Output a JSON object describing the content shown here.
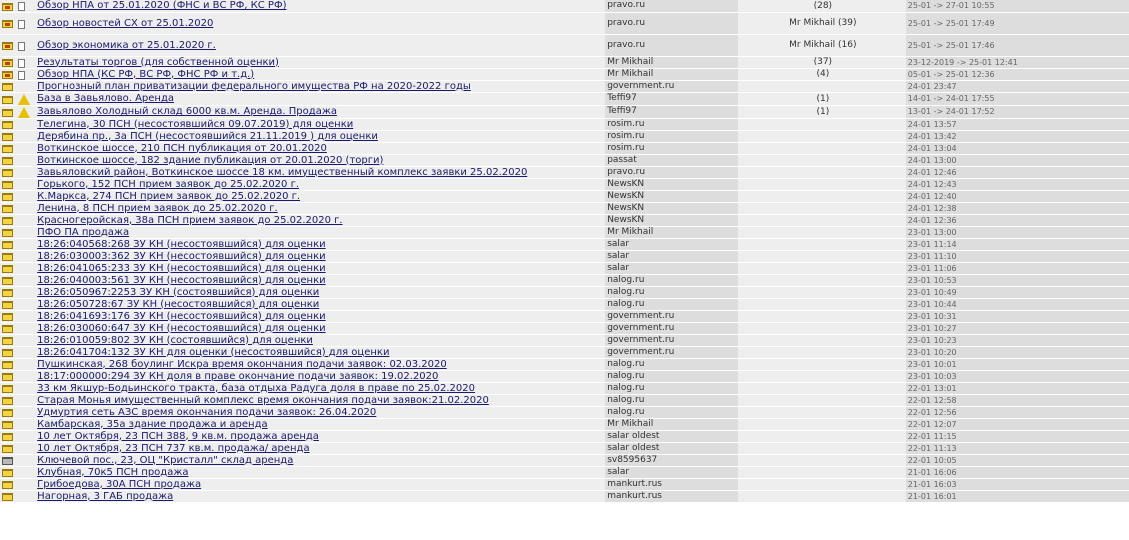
{
  "topics": [
    {
      "icon": "hot",
      "doc": true,
      "title": "Обзор НПА от 25.01.2020 (ФНС и ВС РФ, КС РФ)",
      "author": "pravo.ru",
      "replies": "(28)",
      "date": "25-01 -> 27-01 10:55",
      "tall": false
    },
    {
      "icon": "hot",
      "doc": true,
      "title": "Обзор новостей СХ от 25.01.2020",
      "author": "pravo.ru",
      "replies": "Mr Mikhail\n(39)",
      "date": "25-01 -> 25-01 17:49",
      "tall": true
    },
    {
      "icon": "hot",
      "doc": true,
      "title": "Обзор экономика от 25.01.2020 г.",
      "author": "pravo.ru",
      "replies": "Mr Mikhail\n(16)",
      "date": "25-01 -> 25-01 17:46",
      "tall": true
    },
    {
      "icon": "hot",
      "doc": true,
      "title": "Результаты торгов (для собственной оценки)",
      "author": "Mr Mikhail",
      "replies": "(37)",
      "date": "23-12-2019 -> 25-01 12:41",
      "tall": false
    },
    {
      "icon": "hot",
      "doc": true,
      "title": "Обзор НПА (КС РФ, ВС РФ, ФНС РФ и т.д.)",
      "author": "Mr Mikhail",
      "replies": "(4)",
      "date": "05-01 -> 25-01 12:36",
      "tall": false
    },
    {
      "icon": "folder",
      "doc": false,
      "title": "Прогнозный план приватизации федерального имущества РФ на 2020-2022 годы",
      "author": "government.ru",
      "replies": "",
      "date": "24-01 23:47",
      "tall": false
    },
    {
      "icon": "folder",
      "doc": "warn",
      "title": "База в Завьялово. Аренда",
      "author": "Teffi97",
      "replies": "(1)",
      "date": "14-01 -> 24-01 17:55",
      "tall": false
    },
    {
      "icon": "folder",
      "doc": "warn",
      "title": "Завьялово Холодный склад 6000 кв.м. Аренда. Продажа",
      "author": "Teffi97",
      "replies": "(1)",
      "date": "13-01 -> 24-01 17:52",
      "tall": false
    },
    {
      "icon": "folder",
      "doc": false,
      "title": "Телегина, 30 ПСН (несостоявшийся 09.07.2019) для оценки",
      "author": "rosim.ru",
      "replies": "",
      "date": "24-01 13:57",
      "tall": false
    },
    {
      "icon": "folder",
      "doc": false,
      "title": "Дерябина пр., 3а ПСН (несостоявшийся 21.11.2019 ) для оценки",
      "author": "rosim.ru",
      "replies": "",
      "date": "24-01 13:42",
      "tall": false
    },
    {
      "icon": "folder",
      "doc": false,
      "title": "Воткинское шоссе, 210 ПСН публикация от 20.01.2020",
      "author": "rosim.ru",
      "replies": "",
      "date": "24-01 13:04",
      "tall": false
    },
    {
      "icon": "folder",
      "doc": false,
      "title": "Воткинское шоссе, 182 здание публикация от 20.01.2020 (торги)",
      "author": "passat",
      "replies": "",
      "date": "24-01 13:00",
      "tall": false
    },
    {
      "icon": "folder",
      "doc": false,
      "title": "Завьяловский район, Воткинское шоссе 18 км. имущественный комплекс заявки 25.02.2020",
      "author": "pravo.ru",
      "replies": "",
      "date": "24-01 12:46",
      "tall": false
    },
    {
      "icon": "folder",
      "doc": false,
      "title": "Горького, 152 ПСН прием заявок до 25.02.2020 г.",
      "author": "NewsKN",
      "replies": "",
      "date": "24-01 12:43",
      "tall": false
    },
    {
      "icon": "folder",
      "doc": false,
      "title": "К.Маркса, 274 ПСН прием заявок до 25.02.2020 г.",
      "author": "NewsKN",
      "replies": "",
      "date": "24-01 12:40",
      "tall": false
    },
    {
      "icon": "folder",
      "doc": false,
      "title": "Ленина, 8 ПСН прием заявок до 25.02.2020 г.",
      "author": "NewsKN",
      "replies": "",
      "date": "24-01 12:38",
      "tall": false
    },
    {
      "icon": "folder",
      "doc": false,
      "title": "Красногеройская, 38а ПСН прием заявок до 25.02.2020 г.",
      "author": "NewsKN",
      "replies": "",
      "date": "24-01 12:36",
      "tall": false
    },
    {
      "icon": "folder",
      "doc": false,
      "title": "ПФО ПА продажа",
      "author": "Mr Mikhail",
      "replies": "",
      "date": "23-01 13:00",
      "tall": false
    },
    {
      "icon": "folder",
      "doc": false,
      "title": "18:26:040568:268 ЗУ КН (несостоявшийся) для оценки",
      "author": "salar",
      "replies": "",
      "date": "23-01 11:14",
      "tall": false
    },
    {
      "icon": "folder",
      "doc": false,
      "title": "18:26:030003:362 ЗУ КН (несостоявшийся) для оценки",
      "author": "salar",
      "replies": "",
      "date": "23-01 11:10",
      "tall": false
    },
    {
      "icon": "folder",
      "doc": false,
      "title": "18:26:041065:233 ЗУ КН (несостоявшийся) для оценки",
      "author": "salar",
      "replies": "",
      "date": "23-01 11:06",
      "tall": false
    },
    {
      "icon": "folder",
      "doc": false,
      "title": "18:26:040003:561 ЗУ КН (несостоявшийся) для оценки",
      "author": "nalog.ru",
      "replies": "",
      "date": "23-01 10:53",
      "tall": false
    },
    {
      "icon": "folder",
      "doc": false,
      "title": "18:26:050967:2253 ЗУ КН (состоявшийся) для оценки",
      "author": "nalog.ru",
      "replies": "",
      "date": "23-01 10:49",
      "tall": false
    },
    {
      "icon": "folder",
      "doc": false,
      "title": "18:26:050728:67 ЗУ КН (несостоявшийся) для оценки",
      "author": "nalog.ru",
      "replies": "",
      "date": "23-01 10:44",
      "tall": false
    },
    {
      "icon": "folder",
      "doc": false,
      "title": "18:26:041693:176 ЗУ КН (несостоявшийся) для оценки",
      "author": "government.ru",
      "replies": "",
      "date": "23-01 10:31",
      "tall": false
    },
    {
      "icon": "folder",
      "doc": false,
      "title": "18:26:030060:647 ЗУ КН (несостоявшийся) для оценки",
      "author": "government.ru",
      "replies": "",
      "date": "23-01 10:27",
      "tall": false
    },
    {
      "icon": "folder",
      "doc": false,
      "title": "18:26:010059:802 ЗУ КН (состоявшийся) для оценки",
      "author": "government.ru",
      "replies": "",
      "date": "23-01 10:23",
      "tall": false
    },
    {
      "icon": "folder",
      "doc": false,
      "title": "18:26:041704:132 ЗУ КН для оценки (несостоявшийся) для оценки",
      "author": "government.ru",
      "replies": "",
      "date": "23-01 10:20",
      "tall": false
    },
    {
      "icon": "folder",
      "doc": false,
      "title": "Пушкинская, 268 боулинг Искра время окончания подачи заявок: 02.03.2020",
      "author": "nalog.ru",
      "replies": "",
      "date": "23-01 10:01",
      "tall": false
    },
    {
      "icon": "folder",
      "doc": false,
      "title": "18:17:000000:294 ЗУ КН доля в праве окончание подачи заявок: 19.02.2020",
      "author": "nalog.ru",
      "replies": "",
      "date": "23-01 10:03",
      "tall": false
    },
    {
      "icon": "folder",
      "doc": false,
      "title": "33 км Якшур-Бодьинского тракта, база отдыха Радуга доля в праве по 25.02.2020",
      "author": "nalog.ru",
      "replies": "",
      "date": "22-01 13:01",
      "tall": false
    },
    {
      "icon": "folder",
      "doc": false,
      "title": "Старая Монья имущественный комплекс время окончания подачи заявок:21.02.2020",
      "author": "nalog.ru",
      "replies": "",
      "date": "22-01 12:58",
      "tall": false
    },
    {
      "icon": "folder",
      "doc": false,
      "title": "Удмуртия сеть АЗС время окончания подачи заявок: 26.04.2020",
      "author": "nalog.ru",
      "replies": "",
      "date": "22-01 12:56",
      "tall": false
    },
    {
      "icon": "folder",
      "doc": false,
      "title": "Камбарская, 35а здание продажа и аренда",
      "author": "Mr Mikhail",
      "replies": "",
      "date": "22-01 12:07",
      "tall": false
    },
    {
      "icon": "folder",
      "doc": false,
      "title": "10 лет Октября, 23 ПСН 388, 9 кв.м. продажа аренда",
      "author": "salar oldest",
      "replies": "",
      "date": "22-01 11:15",
      "tall": false
    },
    {
      "icon": "folder",
      "doc": false,
      "title": "10 лет Октября, 23 ПСН 737 кв.м. продажа/ аренда",
      "author": "salar oldest",
      "replies": "",
      "date": "22-01 11:13",
      "tall": false
    },
    {
      "icon": "moved",
      "doc": false,
      "title": "Ключевой пос., 23, ОЦ \"Кристалл\" склад аренда",
      "author": "sv8595637",
      "replies": "",
      "date": "22-01 10:05",
      "tall": false
    },
    {
      "icon": "folder",
      "doc": false,
      "title": "Клубная, 70к5 ПСН продажа",
      "author": "salar",
      "replies": "",
      "date": "21-01 16:06",
      "tall": false
    },
    {
      "icon": "folder",
      "doc": false,
      "title": "Грибоедова, 30А ПСН продажа",
      "author": "mankurt.rus",
      "replies": "",
      "date": "21-01 16:03",
      "tall": false
    },
    {
      "icon": "folder",
      "doc": false,
      "title": "Нагорная, 3 ГАБ продажа",
      "author": "mankurt.rus",
      "replies": "",
      "date": "21-01 16:01",
      "tall": false
    }
  ]
}
